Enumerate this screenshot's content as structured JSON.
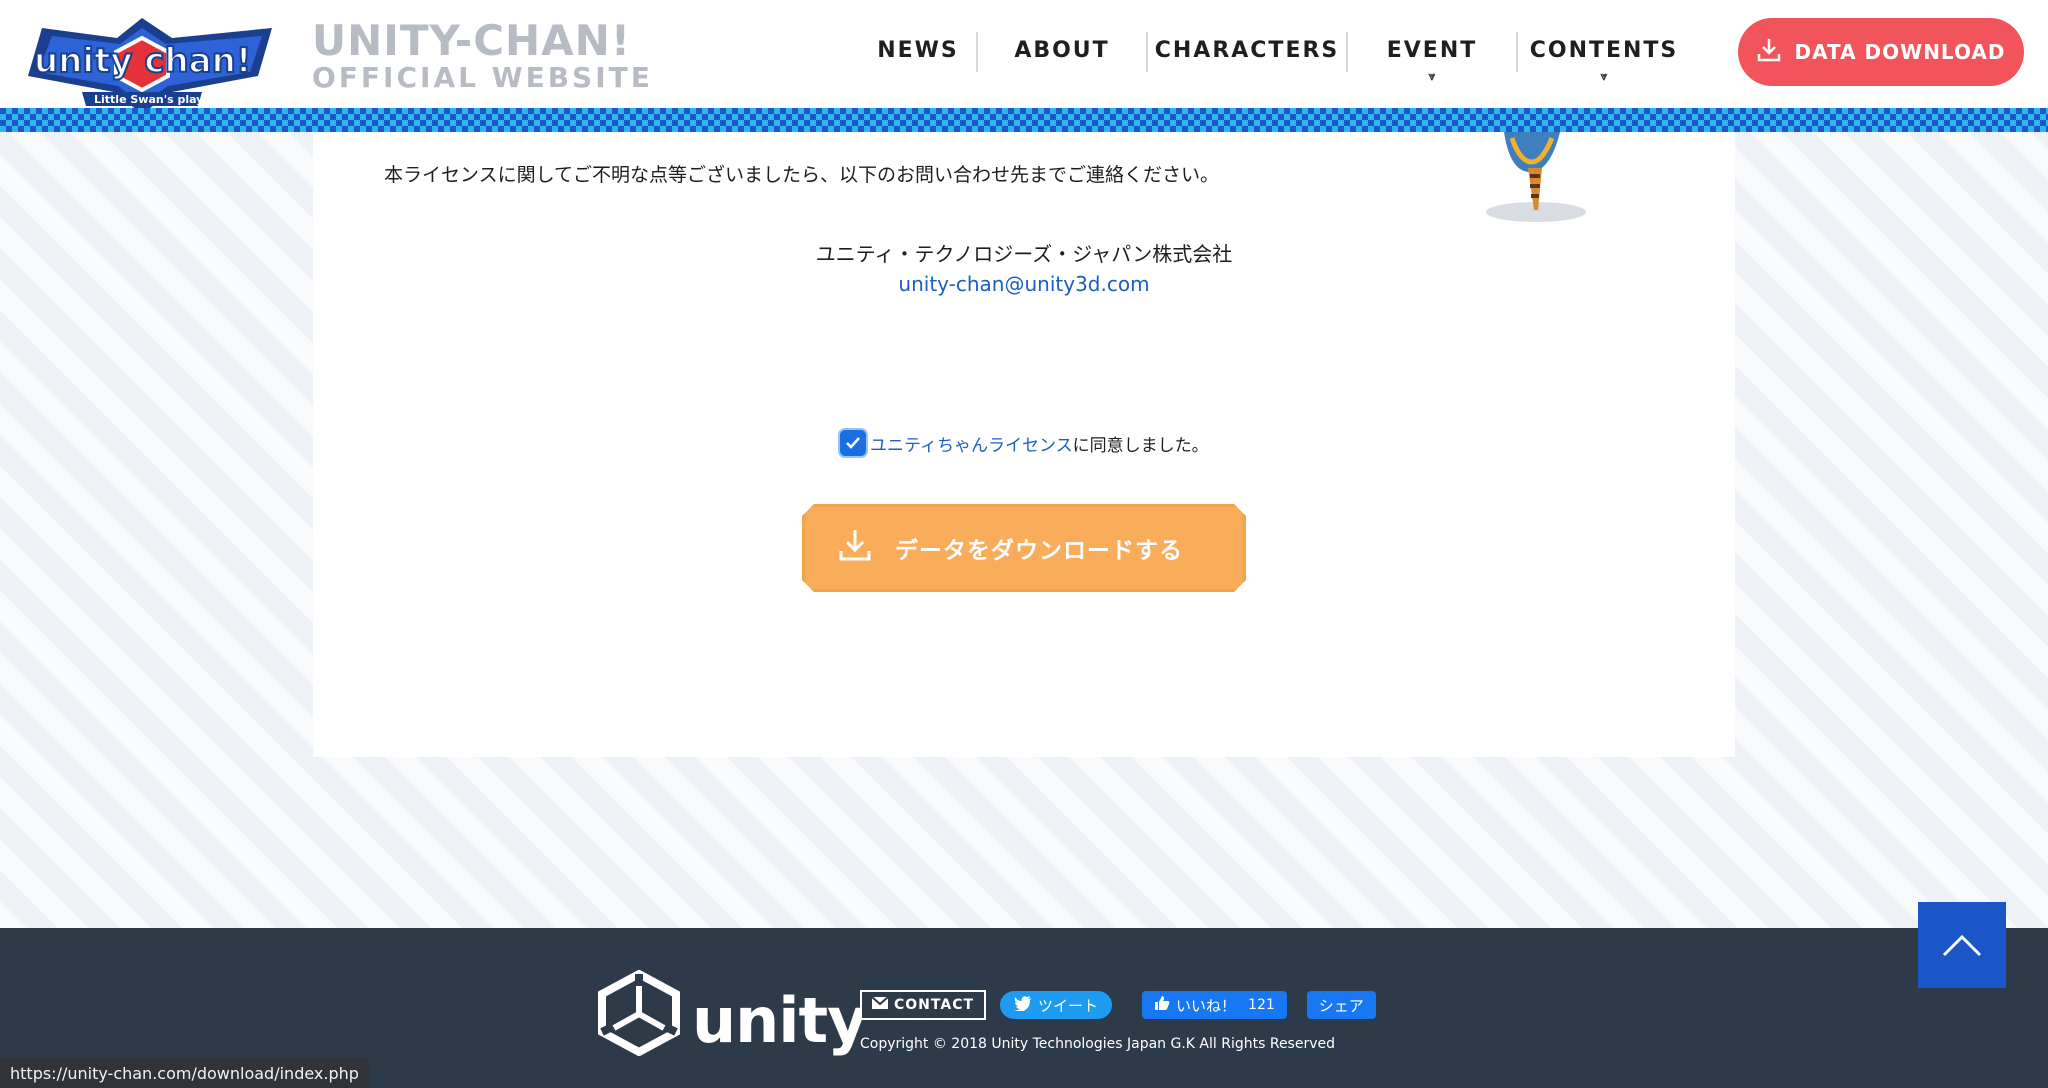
{
  "header": {
    "logo_text": "unity chan!",
    "logo_tagline": "Little Swan's playGROWnd",
    "title_line1": "UNITY-CHAN!",
    "title_line2": "OFFICIAL WEBSITE",
    "nav": [
      {
        "label": "NEWS",
        "has_dropdown": false
      },
      {
        "label": "ABOUT",
        "has_dropdown": false
      },
      {
        "label": "CHARACTERS",
        "has_dropdown": false
      },
      {
        "label": "EVENT",
        "has_dropdown": true
      },
      {
        "label": "CONTENTS",
        "has_dropdown": true
      }
    ],
    "download_button": "DATA DOWNLOAD"
  },
  "content": {
    "license_notice": "本ライセンスに関してご不明な点等ございましたら、以下のお問い合わせ先までご連絡ください。",
    "company": "ユニティ・テクノロジーズ・ジャパン株式会社",
    "email": "unity-chan@unity3d.com",
    "agree_checked": true,
    "agree_link": "ユニティちゃんライセンス",
    "agree_suffix": "に同意しました。",
    "download_button": "データをダウンロードする"
  },
  "footer": {
    "unity_wordmark": "unity",
    "contact_label": "CONTACT",
    "tweet_label": "ツイート",
    "like_label": "いいね！",
    "like_count": "121",
    "share_label": "シェア",
    "copyright": "Copyright © 2018 Unity Technologies Japan G.K All Rights Reserved"
  },
  "status_url": "https://unity-chan.com/download/index.php",
  "colors": {
    "accent_red": "#f2545b",
    "accent_orange": "#f9ad5a",
    "link_blue": "#1b5ec4",
    "footer_bg": "#2d3a49",
    "back_to_top": "#1b56c8"
  }
}
